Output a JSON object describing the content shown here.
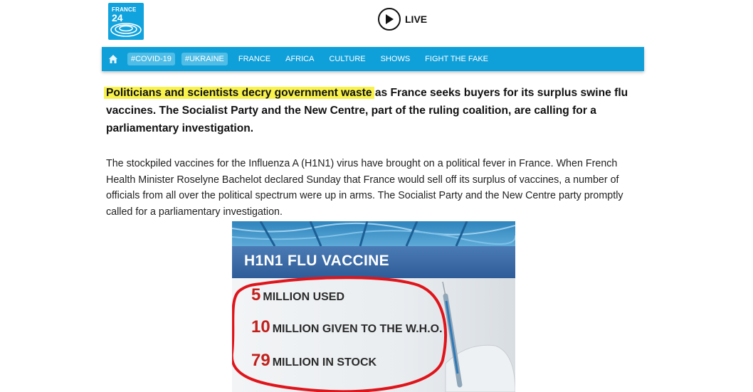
{
  "header": {
    "logo_line1": "FRANCE",
    "logo_line2": "24",
    "live_label": "LIVE"
  },
  "nav": {
    "tags": [
      "#COVID-19",
      "#UKRAINE"
    ],
    "items": [
      "FRANCE",
      "AFRICA",
      "CULTURE",
      "SHOWS",
      "FIGHT THE FAKE"
    ]
  },
  "article": {
    "lead_highlight": "Politicians and scientists decry government waste",
    "lead_rest": " as France seeks buyers for its surplus swine flu vaccines. The Socialist Party and the New Centre, part of the ruling coalition, are calling for a parliamentary investigation.",
    "body": "The stockpiled vaccines for the Influenza A (H1N1) virus have brought on a political fever in France. When French Health Minister Roselyne Bachelot declared Sunday that France would sell off its surplus of vaccines, a number of officials from all over the political spectrum were up in arms. The Socialist Party and the New Centre party promptly called for a parliamentary investigation."
  },
  "figure": {
    "title": "H1N1 FLU VACCINE",
    "stats": [
      {
        "num": "5",
        "text": "MILLION USED"
      },
      {
        "num": "10",
        "text": "MILLION GIVEN TO THE W.H.O."
      },
      {
        "num": "79",
        "text": "MILLION IN STOCK"
      }
    ]
  },
  "colors": {
    "brand": "#10a0d9",
    "tag_bg": "#4fbde6",
    "highlight": "#f8f24b",
    "annotation": "#e0141b"
  },
  "icons": {
    "live": "play-icon",
    "home": "home-icon"
  }
}
